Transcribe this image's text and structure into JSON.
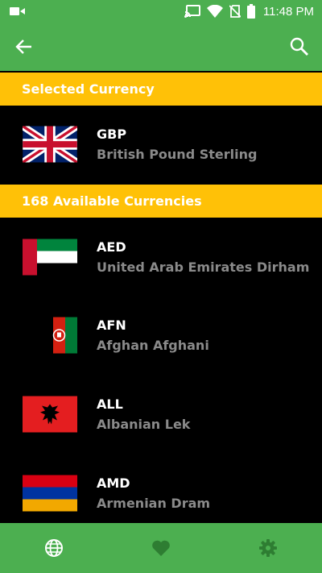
{
  "status_bar": {
    "time": "11:48 PM",
    "icons": [
      "video-icon",
      "cast-icon",
      "wifi-icon",
      "no-sim-icon",
      "battery-icon"
    ]
  },
  "app_bar": {
    "icons": [
      "back-arrow-icon",
      "search-icon"
    ]
  },
  "selected_section": {
    "title": "Selected Currency"
  },
  "selected_currency": {
    "code": "GBP",
    "name": "British Pound Sterling",
    "flag": "uk-flag"
  },
  "available_section": {
    "title": "168 Available Currencies"
  },
  "currencies": [
    {
      "code": "AED",
      "name": "United Arab Emirates Dirham",
      "flag": "uae-flag"
    },
    {
      "code": "AFN",
      "name": "Afghan Afghani",
      "flag": "afghanistan-flag"
    },
    {
      "code": "ALL",
      "name": "Albanian Lek",
      "flag": "albania-flag"
    },
    {
      "code": "AMD",
      "name": "Armenian Dram",
      "flag": "armenia-flag"
    }
  ],
  "bottom_nav": {
    "items": [
      "globe-icon",
      "heart-icon",
      "gear-icon"
    ],
    "active_index": 0
  },
  "colors": {
    "primary": "#4caf50",
    "section": "#ffc107",
    "background": "#000000",
    "secondary_text": "#8a8a8a",
    "inactive_nav_icon": "#2e7d32"
  }
}
